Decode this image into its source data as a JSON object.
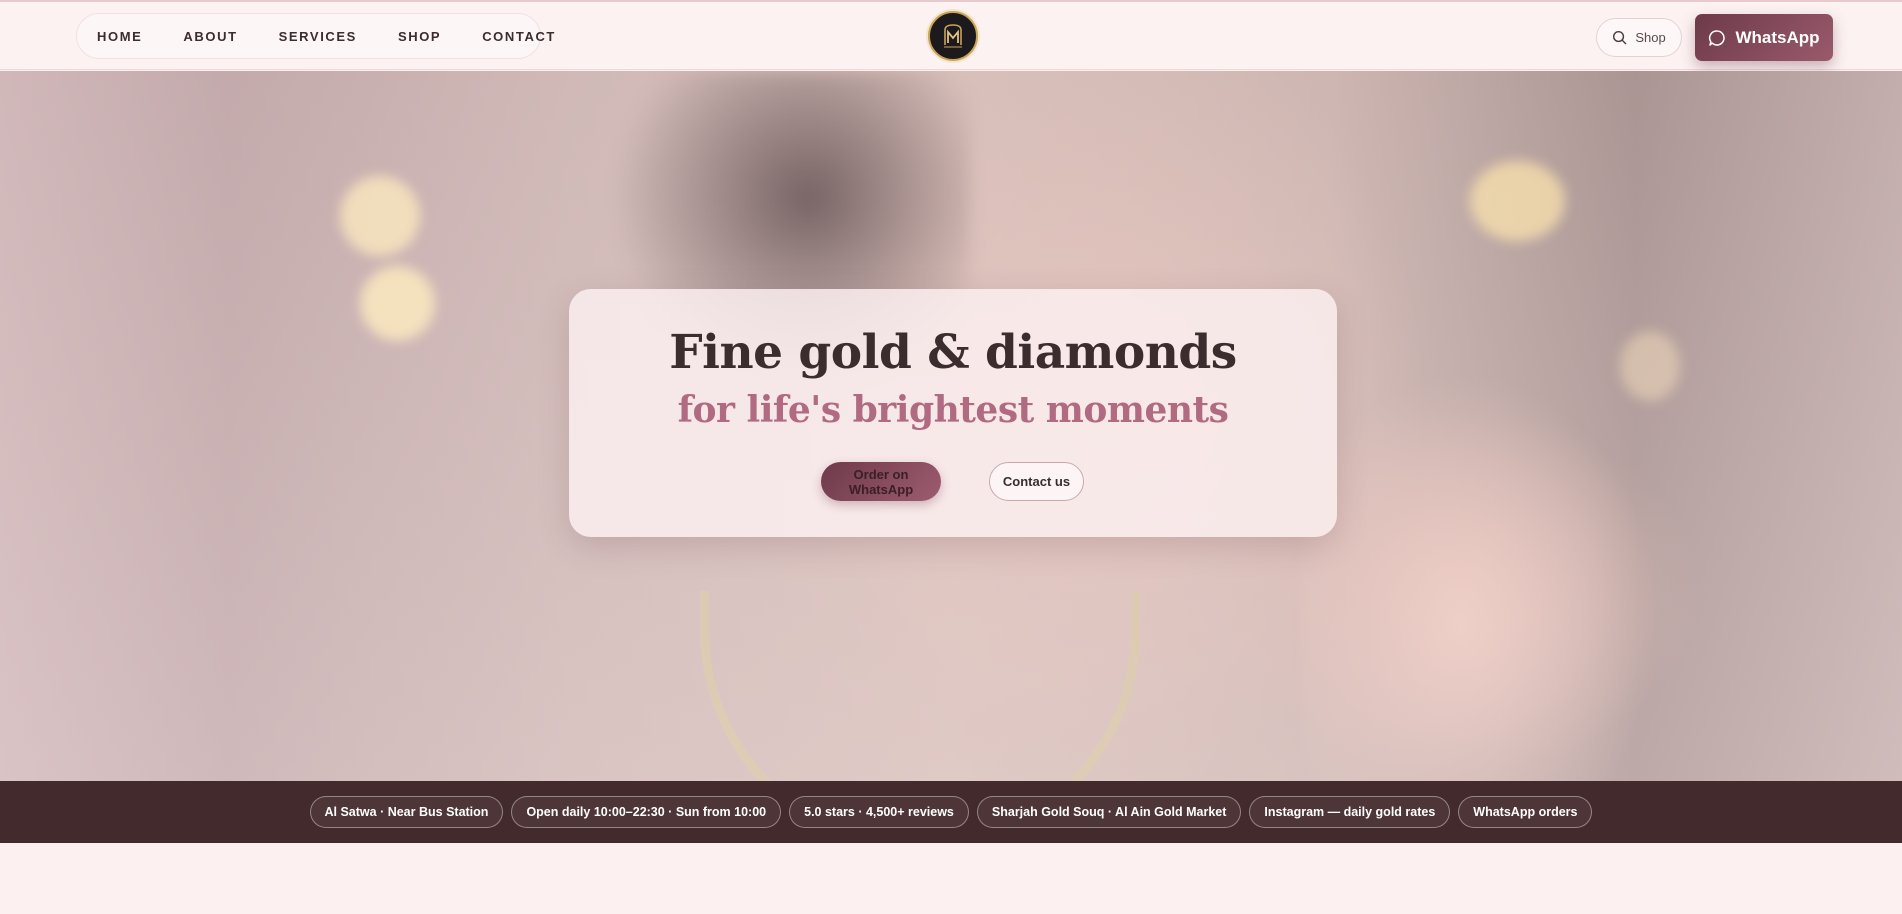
{
  "nav": {
    "items": [
      {
        "label": "HOME"
      },
      {
        "label": "ABOUT"
      },
      {
        "label": "SERVICES"
      },
      {
        "label": "SHOP"
      },
      {
        "label": "CONTACT"
      }
    ]
  },
  "logo": {
    "icon": "brand-monogram-logo",
    "letter": "M"
  },
  "header_actions": {
    "search_label": "Shop",
    "search_icon": "search-icon",
    "whatsapp_label": "WhatsApp",
    "whatsapp_icon": "chat-bubble-icon"
  },
  "hero": {
    "title": "Fine gold & diamonds",
    "subtitle": "for life's brightest moments",
    "primary_cta": "Order on WhatsApp",
    "secondary_cta": "Contact us"
  },
  "info_chips": [
    "Al Satwa · Near Bus Station",
    "Open daily 10:00–22:30 · Sun from 10:00",
    "5.0 stars · 4,500+ reviews",
    "Sharjah Gold Souq · Al Ain Gold Market",
    "Instagram — daily gold rates",
    "WhatsApp orders"
  ],
  "colors": {
    "accent": "#8a4c5f",
    "subtitle": "#b06a82",
    "strip": "#432a2c",
    "page_bg": "#fbeeee"
  }
}
